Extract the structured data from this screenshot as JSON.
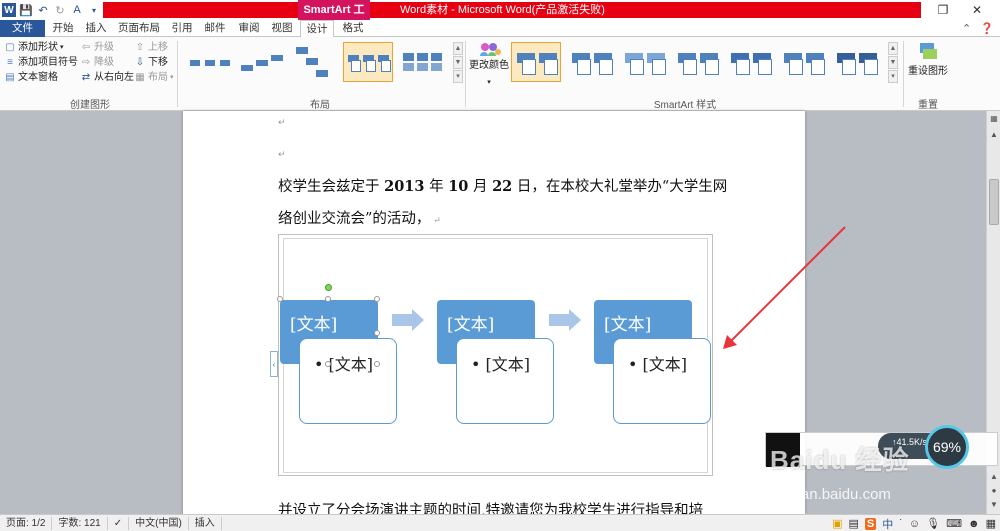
{
  "window": {
    "title": "Word素材 - Microsoft Word(产品激活失败)",
    "context_tab_group": "SmartArt 工具"
  },
  "tabs": [
    "文件",
    "开始",
    "插入",
    "页面布局",
    "引用",
    "邮件",
    "审阅",
    "视图",
    "设计",
    "格式"
  ],
  "ribbon": {
    "create_graphic": {
      "label": "创建图形",
      "add_shape": "添加形状",
      "add_bullet": "添加项目符号",
      "text_pane": "文本窗格",
      "promote": "升级",
      "demote": "降级",
      "right_to_left": "从右向左",
      "move_up": "上移",
      "move_down": "下移",
      "layout": "布局"
    },
    "layouts": {
      "label": "布局"
    },
    "styles": {
      "label": "SmartArt 样式",
      "change_colors": "更改颜色"
    },
    "reset": {
      "label": "重置",
      "reset_graphic": "重设图形"
    }
  },
  "document": {
    "para1_a": "校学生会兹定于 ",
    "para1_year": "2013",
    "para1_b": " 年 ",
    "para1_month": "10",
    "para1_c": " 月 ",
    "para1_day": "22",
    "para1_d": " 日，在本校大礼堂举办“大学生网",
    "para2": "络创业交流会”的活动，",
    "para3": "并设立了分会场演讲主题的时间,特邀请您为我校学生进行指导和培",
    "smartart": {
      "headers": [
        "[文本]",
        "[文本]",
        "[文本]"
      ],
      "bullets": [
        "• [文本]",
        "• [文本]",
        "• [文本]"
      ]
    }
  },
  "status": {
    "page": "页面: 1/2",
    "words": "字数: 121",
    "lang": "中文(中国)",
    "mode": "插入"
  },
  "overlay": {
    "speed": "↑41.5K/s",
    "percent": "69%",
    "watermark": "Baidu 经验",
    "watermark_url": "jingyan.baidu.com"
  }
}
